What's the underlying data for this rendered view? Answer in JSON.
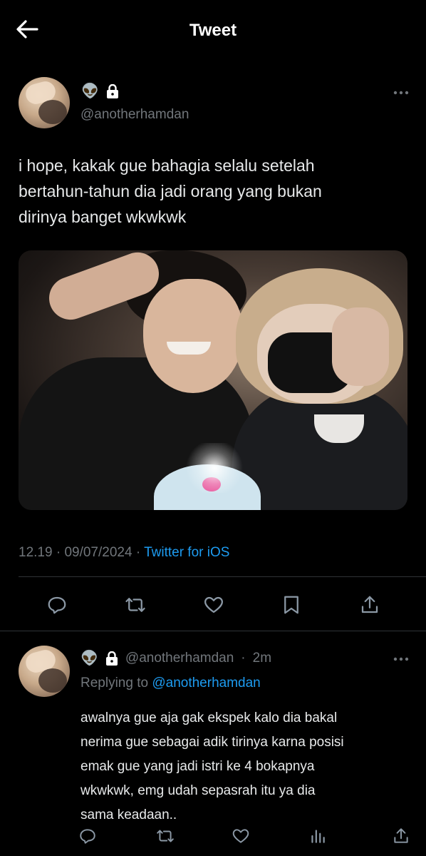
{
  "header": {
    "title": "Tweet",
    "back_icon": "arrow-left-icon"
  },
  "tweet": {
    "author_emojis": [
      "👽"
    ],
    "author_handle": "@anotherhamdan",
    "text_lines": [
      "i hope, kakak gue bahagia selalu setelah",
      "bertahun-tahun dia jadi orang yang bukan",
      "dirinya banget wkwkwk"
    ],
    "time": "12.19",
    "date": "09/07/2024",
    "separator": "·",
    "source": "Twitter for iOS",
    "actions": [
      "reply-icon",
      "retweet-icon",
      "like-icon",
      "bookmark-icon",
      "share-icon"
    ]
  },
  "reply": {
    "author_emojis": [
      "👽"
    ],
    "author_handle": "@anotherhamdan",
    "separator": "·",
    "time_ago": "2m",
    "replying_label": "Replying to",
    "replying_mention": "@anotherhamdan",
    "text_lines": [
      "awalnya gue aja gak ekspek kalo dia bakal",
      "nerima gue sebagai adik tirinya karna posisi",
      "emak gue yang jadi istri ke 4 bokapnya",
      "wkwkwk, emg udah sepasrah itu ya dia",
      "sama keadaan.."
    ],
    "actions": [
      "reply-icon",
      "retweet-icon",
      "like-icon",
      "views-icon",
      "share-icon"
    ]
  },
  "colors": {
    "background": "#000000",
    "text": "#e7e9ea",
    "muted": "#71767b",
    "accent": "#1d9bf0",
    "divider": "#2f3336"
  }
}
